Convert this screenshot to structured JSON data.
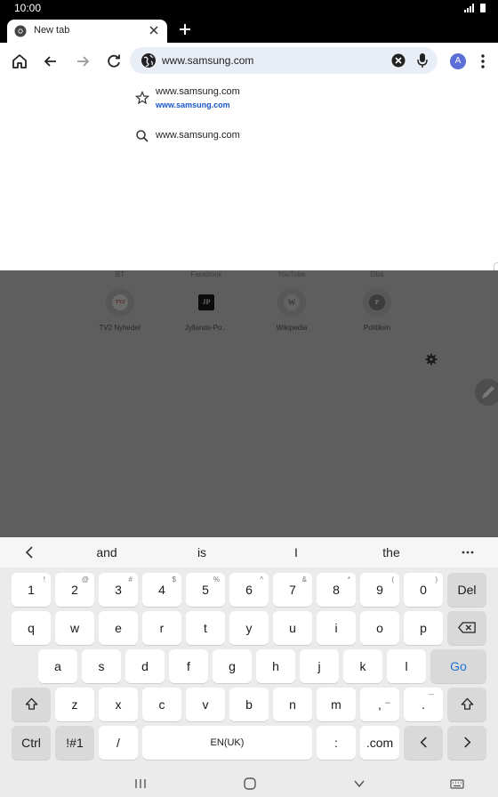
{
  "status": {
    "time": "10:00"
  },
  "tab": {
    "title": "New tab"
  },
  "omnibox": {
    "url": "www.samsung.com"
  },
  "profile": {
    "initial": "A"
  },
  "suggestions": [
    {
      "text": "www.samsung.com",
      "subtext": "www.samsung.com",
      "icon": "star-icon"
    },
    {
      "text": "www.samsung.com",
      "icon": "search-icon"
    }
  ],
  "shortcuts": {
    "top_row": [
      "BT",
      "Facebook",
      "YouTube",
      "Dba"
    ],
    "tiles": [
      {
        "label": "TV2 Nyheder",
        "glyph": "TV2"
      },
      {
        "label": "Jyllands-Po...",
        "glyph": "JP"
      },
      {
        "label": "Wikipedia",
        "glyph": "W"
      },
      {
        "label": "Politiken",
        "glyph": "P"
      }
    ]
  },
  "keyboard": {
    "predictions": [
      "and",
      "is",
      "I",
      "the"
    ],
    "number_row": [
      {
        "key": "1",
        "hint": "!"
      },
      {
        "key": "2",
        "hint": "@"
      },
      {
        "key": "3",
        "hint": "#"
      },
      {
        "key": "4",
        "hint": "$"
      },
      {
        "key": "5",
        "hint": "%"
      },
      {
        "key": "6",
        "hint": "^"
      },
      {
        "key": "7",
        "hint": "&"
      },
      {
        "key": "8",
        "hint": "*"
      },
      {
        "key": "9",
        "hint": "("
      },
      {
        "key": "0",
        "hint": ")"
      }
    ],
    "del_label": "Del",
    "row1": [
      "q",
      "w",
      "e",
      "r",
      "t",
      "y",
      "u",
      "i",
      "o",
      "p"
    ],
    "row2": [
      "a",
      "s",
      "d",
      "f",
      "g",
      "h",
      "j",
      "k",
      "l"
    ],
    "go_label": "Go",
    "row3": [
      "z",
      "x",
      "c",
      "v",
      "b",
      "n",
      "m"
    ],
    "comma": {
      "key": ",",
      "hint": "–"
    },
    "period": {
      "key": ".",
      "hint": "¯"
    },
    "ctrl_label": "Ctrl",
    "symbols_label": "!#1",
    "slash_label": "/",
    "space_label": "EN(UK)",
    "colon_label": ":",
    "dotcom_label": ".com"
  },
  "colors": {
    "accent": "#1e73d8",
    "avatar": "#5b6fd6"
  }
}
